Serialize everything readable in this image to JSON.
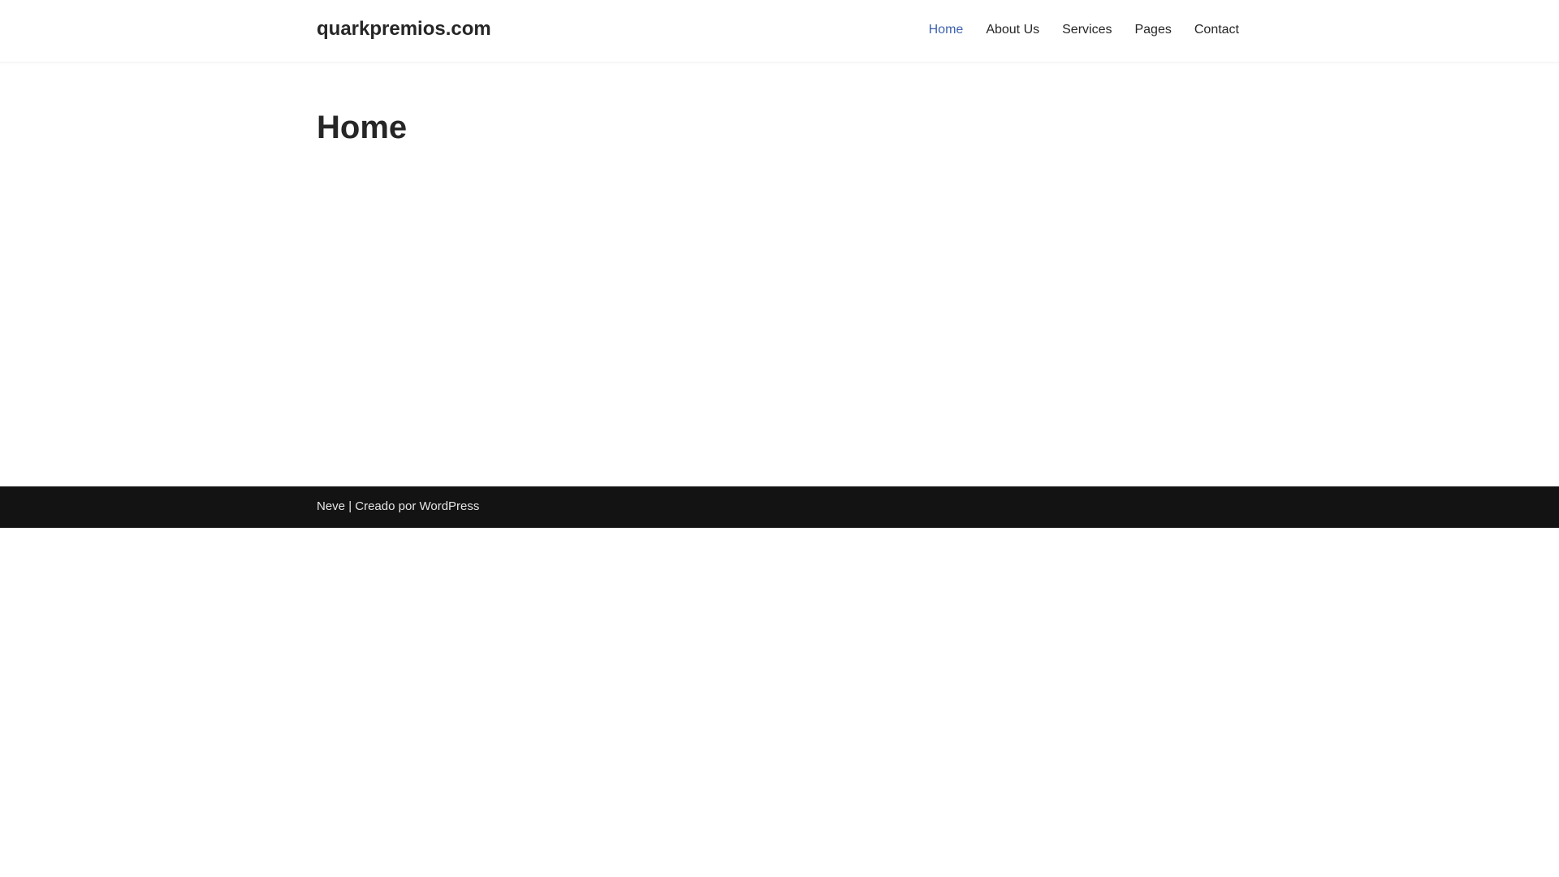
{
  "header": {
    "site_title": "quarkpremios.com",
    "nav": [
      {
        "label": "Home"
      },
      {
        "label": "About Us"
      },
      {
        "label": "Services"
      },
      {
        "label": "Pages"
      },
      {
        "label": "Contact"
      }
    ],
    "active_color": "#3f63ad"
  },
  "main": {
    "title": "Home"
  },
  "footer": {
    "theme_link": "Neve",
    "separator": " | ",
    "credit_prefix": "Creado por ",
    "wp_link": "WordPress"
  }
}
